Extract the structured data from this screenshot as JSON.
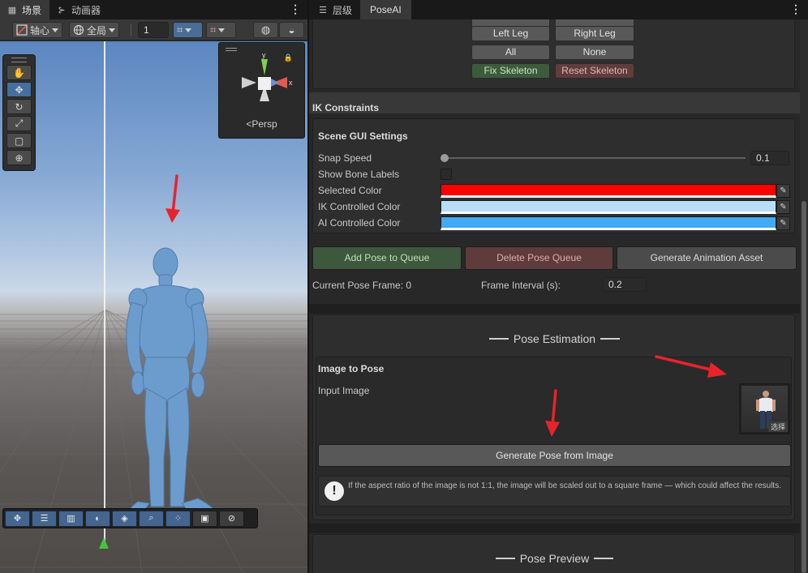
{
  "scene_panel": {
    "tabs": [
      {
        "label": "场景",
        "icon": "grid-icon"
      },
      {
        "label": "动画器",
        "icon": "animator-icon"
      }
    ],
    "toolbar": {
      "pivot_label": "轴心",
      "global_label": "全局",
      "grid_size_value": "1"
    },
    "tools": [
      "hand-tool",
      "move-tool",
      "rotate-tool",
      "scale-tool",
      "rect-tool",
      "transform-tool"
    ],
    "gizmo": {
      "y_label": "y",
      "x_label": "x",
      "projection_label": "Persp"
    },
    "bottom_tools": [
      "move-icon",
      "snap-icon",
      "grid-icon",
      "shading-icon",
      "layers-icon",
      "search-icon",
      "pivot-icon",
      "camera-icon",
      "compass-icon"
    ]
  },
  "inspector_panel": {
    "tabs": [
      {
        "label": "层级",
        "icon": "hierarchy-icon"
      },
      {
        "label": "PoseAI"
      }
    ],
    "limb_buttons": {
      "left_leg": "Left Leg",
      "right_leg": "Right Leg",
      "all": "All",
      "none": "None",
      "fix_skeleton": "Fix Skeleton",
      "reset_skeleton": "Reset Skeleton"
    },
    "ik_constraints_label": "IK Constraints",
    "scene_gui": {
      "title": "Scene GUI Settings",
      "snap_speed_label": "Snap Speed",
      "snap_speed_value": "0.1",
      "show_bone_labels_label": "Show Bone Labels",
      "show_bone_labels_checked": false,
      "selected_color_label": "Selected Color",
      "selected_color": "#ff0000",
      "ik_color_label": "IK Controlled Color",
      "ik_color": "#b9ddf6",
      "ai_color_label": "AI Controlled Color",
      "ai_color": "#40aaf2"
    },
    "queue_buttons": {
      "add": "Add Pose to Queue",
      "delete": "Delete Pose Queue",
      "generate": "Generate Animation Asset"
    },
    "current_pose_frame_label": "Current Pose Frame: 0",
    "frame_interval_label": "Frame Interval (s):",
    "frame_interval_value": "0.2",
    "pose_estimation": {
      "title": "Pose Estimation",
      "image_to_pose_title": "Image to Pose",
      "input_image_label": "Input Image",
      "choose_label": "选择",
      "generate_button": "Generate Pose from Image",
      "help_text": "If the aspect ratio of the image is not 1:1, the image will be scaled out to a square frame — which could affect the results."
    },
    "pose_preview_title": "Pose Preview"
  },
  "colors": {
    "annotation_arrow": "#e8232a",
    "accent_blue": "#4a6d97",
    "green_button": "#3e5a3d",
    "red_button": "#5f3d3d"
  }
}
